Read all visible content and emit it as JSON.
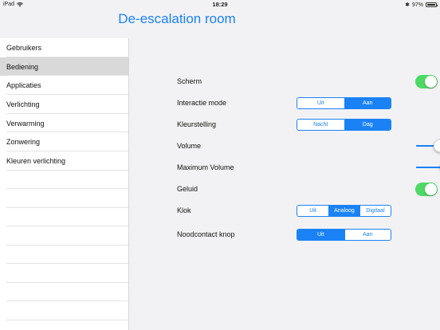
{
  "status": {
    "device": "iPad",
    "time": "18:29",
    "battery": "97%",
    "battery_level": 0.97
  },
  "title": "De-escalation room",
  "sidebar": {
    "items": [
      {
        "label": "Gebruikers"
      },
      {
        "label": "Bediening",
        "selected": true
      },
      {
        "label": "Applicaties"
      },
      {
        "label": "Verlichting"
      },
      {
        "label": "Verwarming"
      },
      {
        "label": "Zonwering"
      },
      {
        "label": "Kleuren verlichting"
      }
    ]
  },
  "settings": {
    "scherm": {
      "label": "Scherm",
      "on": true
    },
    "interactie": {
      "label": "Interactie mode",
      "options": [
        "Uit",
        "Aan"
      ],
      "selected": "Aan"
    },
    "kleurstelling": {
      "label": "Kleurstelling",
      "options": [
        "Nacht",
        "Dag"
      ],
      "selected": "Dag"
    },
    "volume": {
      "label": "Volume",
      "value": 0.25
    },
    "max_volume": {
      "label": "Maximum Volume",
      "value": 0.32
    },
    "geluid": {
      "label": "Geluid",
      "on": true
    },
    "klok": {
      "label": "Klok",
      "options": [
        "Uit",
        "Analoog",
        "Digitaal"
      ],
      "selected": "Analoog"
    },
    "noodcontact": {
      "label": "Noodcontact knop",
      "options": [
        "Uit",
        "Aan"
      ],
      "selected": "Uit"
    }
  },
  "colors": {
    "accent": "#1a82f5",
    "switch_on": "#4cd964",
    "selected_row": "#d9d9d9"
  }
}
